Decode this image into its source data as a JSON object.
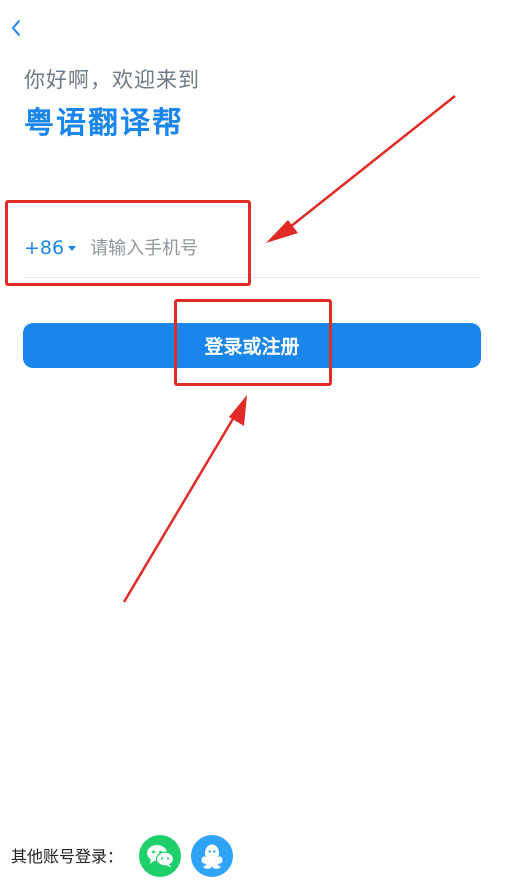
{
  "header": {
    "back_icon": "chevron-left-icon"
  },
  "welcome": {
    "greeting": "你好啊，欢迎来到",
    "app_name": "粤语翻译帮"
  },
  "form": {
    "country_code": "+86",
    "country_dropdown_icon": "caret-down-icon",
    "phone_placeholder": "请输入手机号",
    "submit_label": "登录或注册"
  },
  "other_login": {
    "label": "其他账号登录：",
    "providers": [
      {
        "icon": "wechat-icon",
        "color": "#1fcf6a"
      },
      {
        "icon": "qq-icon",
        "color": "#2fa3f5"
      }
    ]
  },
  "colors": {
    "accent": "#1a86ec",
    "annotation": "#e02b27"
  }
}
